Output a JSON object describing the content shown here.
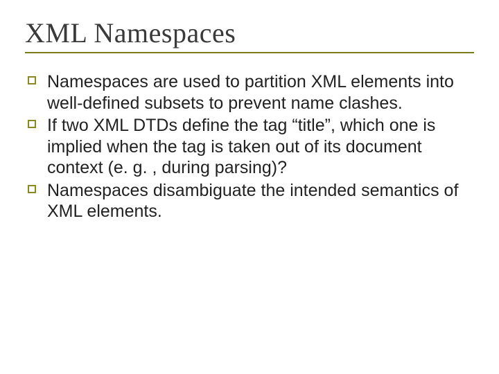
{
  "slide": {
    "title": "XML Namespaces",
    "bullets": [
      "Namespaces are used to partition XML elements into well-defined subsets to prevent name clashes.",
      "If two XML DTDs define the tag “title”, which one is implied when the tag is taken out of its document context (e. g. , during parsing)?",
      "Namespaces disambiguate the intended semantics of XML elements."
    ]
  }
}
